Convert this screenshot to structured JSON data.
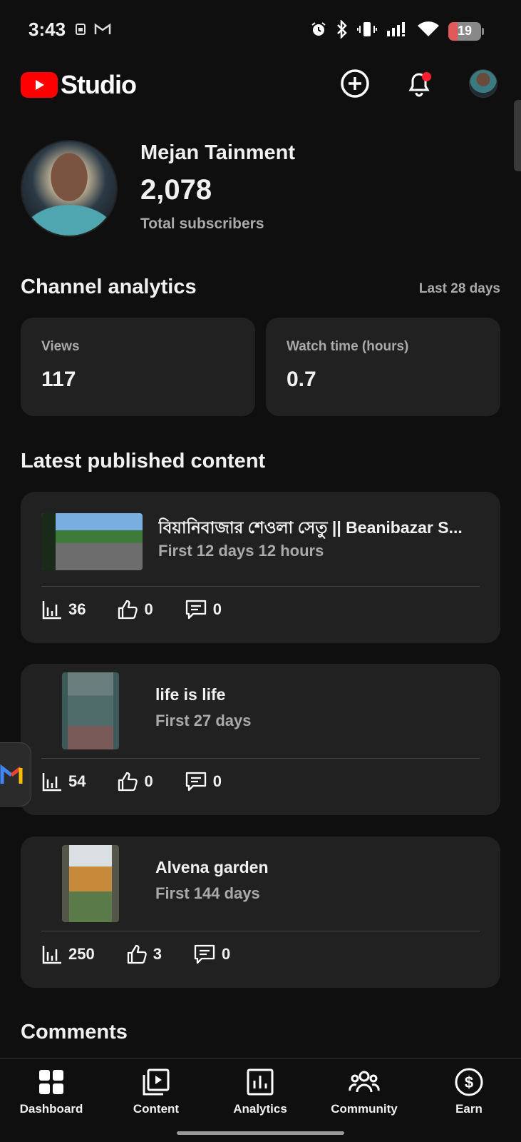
{
  "status_bar": {
    "time": "3:43",
    "battery": "19"
  },
  "header": {
    "logo_text": "Studio"
  },
  "channel": {
    "name": "Mejan Tainment",
    "subscriber_count": "2,078",
    "subscriber_label": "Total subscribers"
  },
  "analytics": {
    "title": "Channel analytics",
    "period": "Last 28 days",
    "cards": [
      {
        "label": "Views",
        "value": "117"
      },
      {
        "label": "Watch time (hours)",
        "value": "0.7"
      }
    ]
  },
  "latest": {
    "title": "Latest published content",
    "items": [
      {
        "title": "বিয়ানিবাজার শেওলা সেতু || Beanibazar S...",
        "subtitle": "First 12 days 12 hours",
        "views": "36",
        "likes": "0",
        "comments": "0"
      },
      {
        "title": "life is life",
        "subtitle": "First 27 days",
        "views": "54",
        "likes": "0",
        "comments": "0"
      },
      {
        "title": "Alvena garden",
        "subtitle": "First 144 days",
        "views": "250",
        "likes": "3",
        "comments": "0"
      }
    ]
  },
  "comments": {
    "title": "Comments"
  },
  "nav": {
    "items": [
      {
        "label": "Dashboard",
        "icon": "dashboard-icon"
      },
      {
        "label": "Content",
        "icon": "content-icon"
      },
      {
        "label": "Analytics",
        "icon": "analytics-icon"
      },
      {
        "label": "Community",
        "icon": "community-icon"
      },
      {
        "label": "Earn",
        "icon": "earn-icon"
      }
    ]
  }
}
